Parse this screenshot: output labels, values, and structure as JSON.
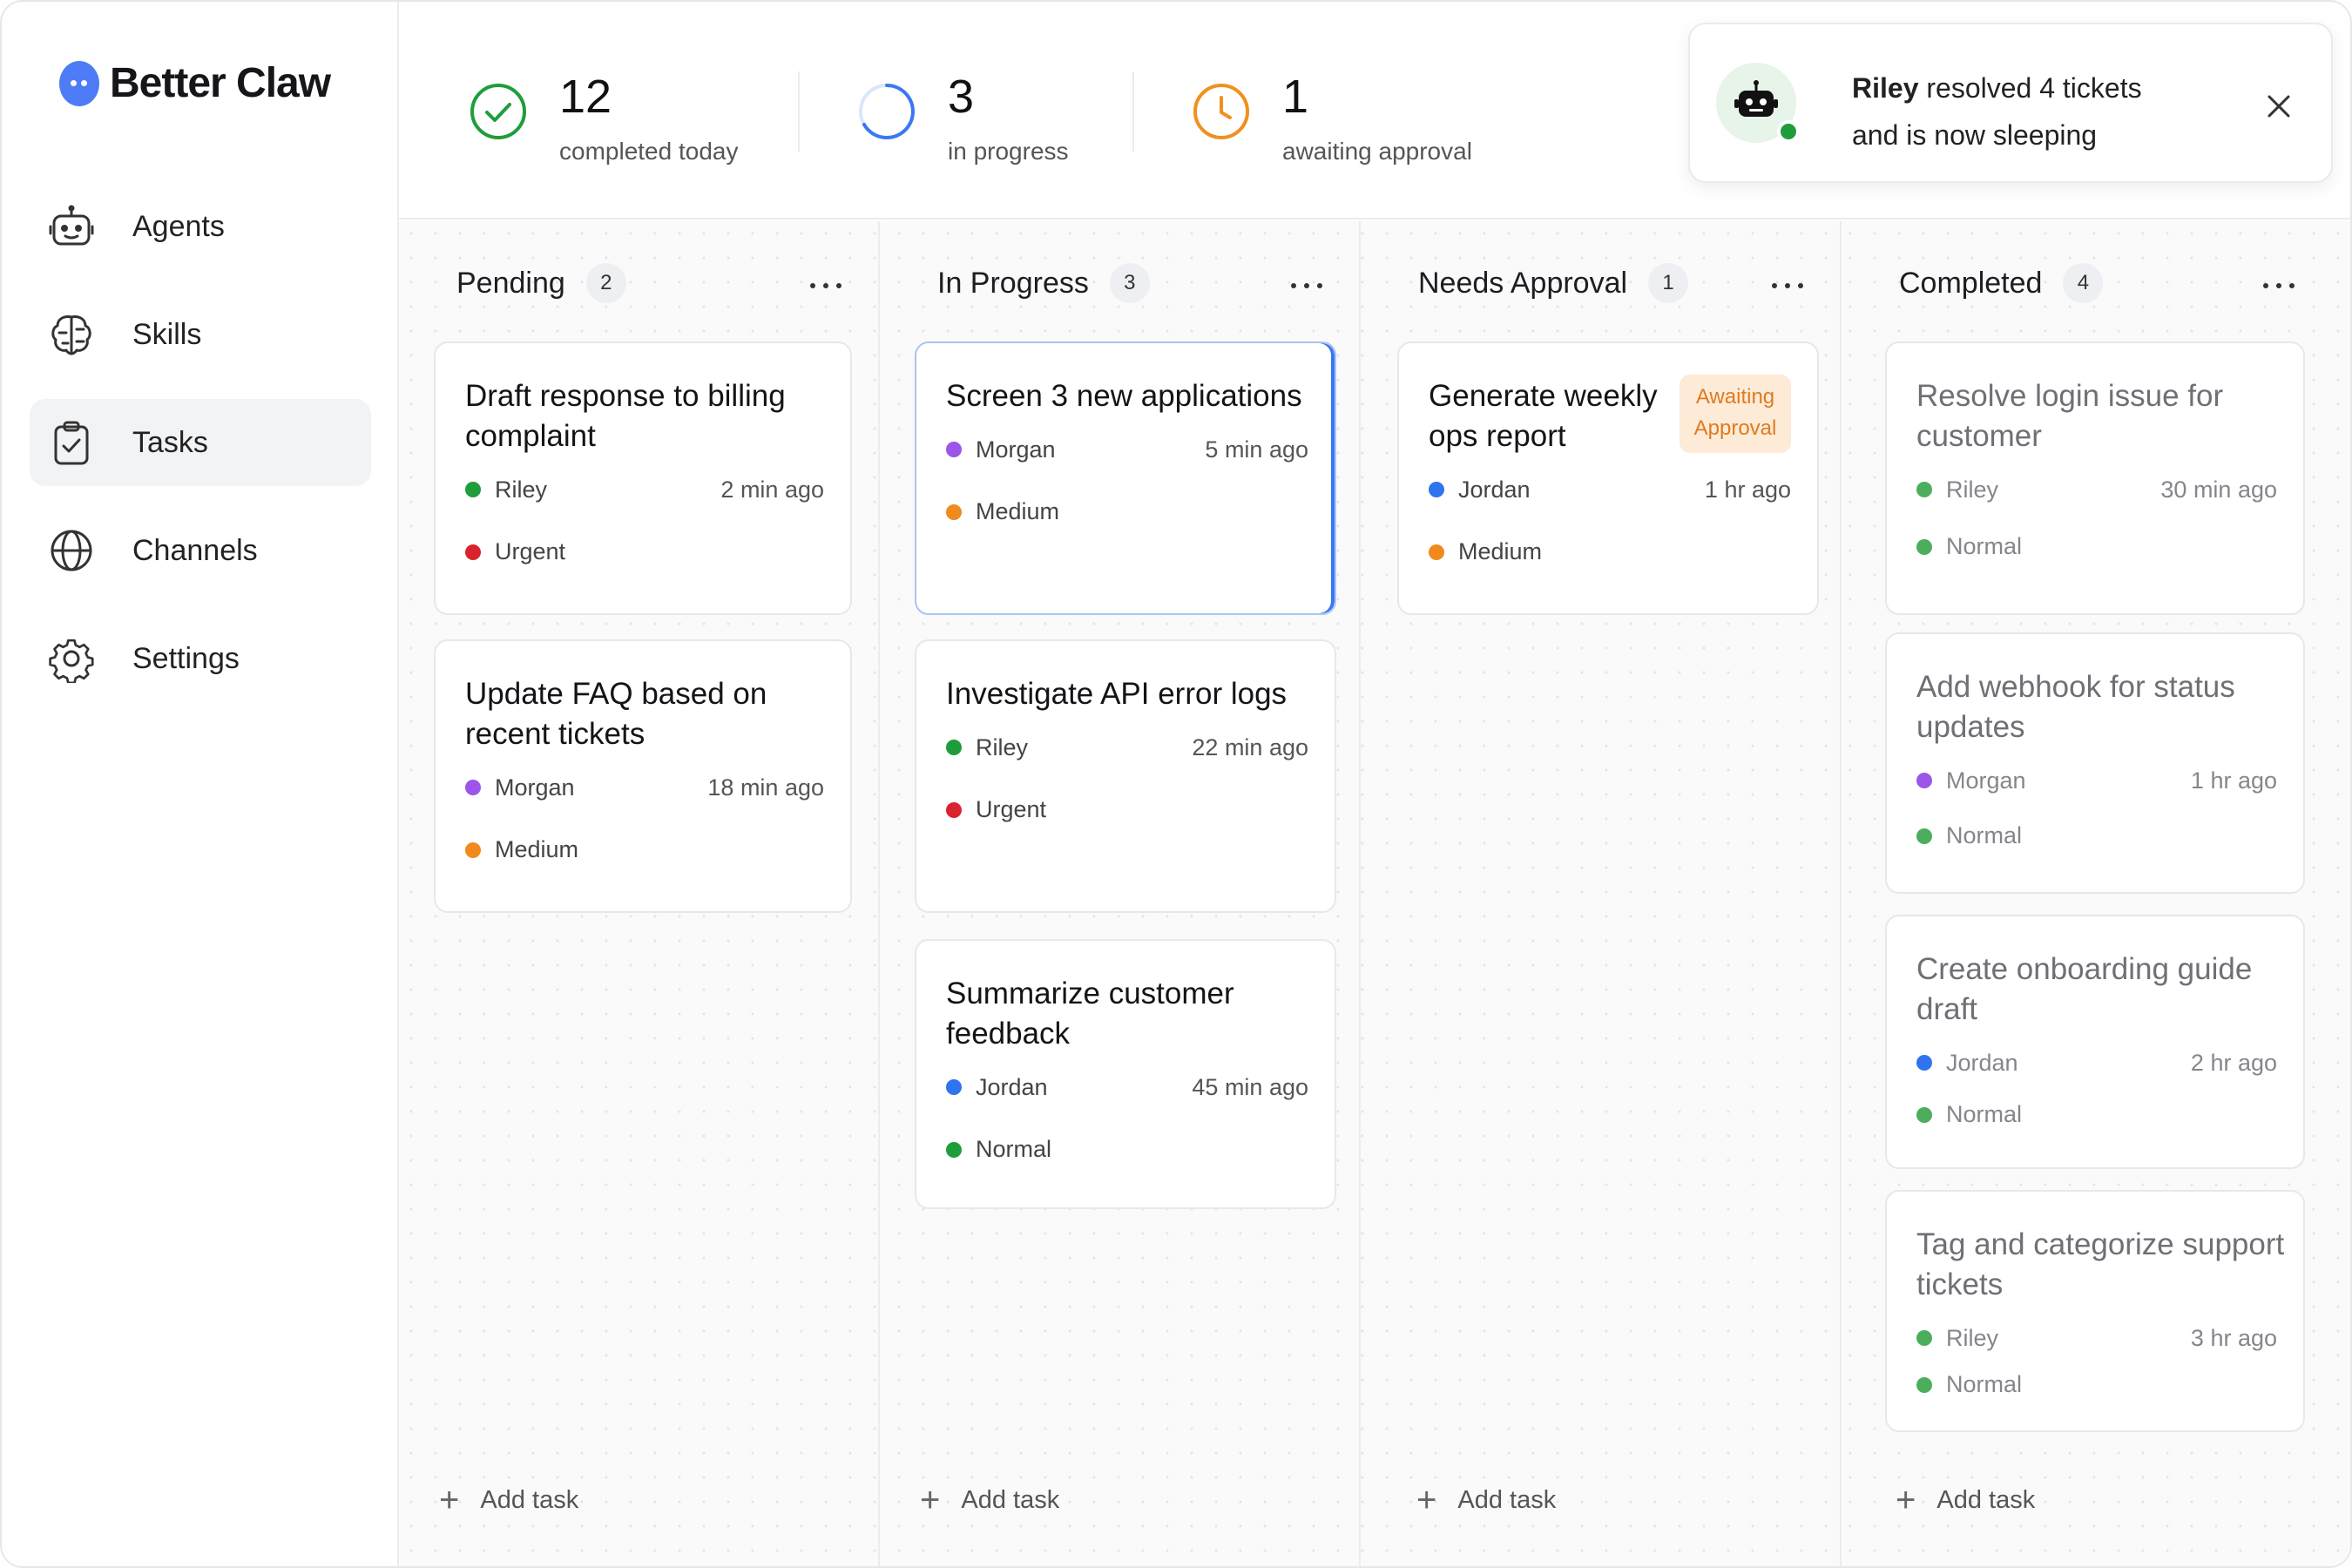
{
  "brand": {
    "name": "Better Claw"
  },
  "sidebar": {
    "items": [
      {
        "label": "Agents",
        "icon": "robot-icon"
      },
      {
        "label": "Skills",
        "icon": "brain-icon"
      },
      {
        "label": "Tasks",
        "icon": "clipboard-check-icon",
        "active": true
      },
      {
        "label": "Channels",
        "icon": "globe-icon"
      },
      {
        "label": "Settings",
        "icon": "gear-icon"
      }
    ]
  },
  "stats": [
    {
      "value": "12",
      "label": "completed today",
      "icon": "check-circle-icon",
      "color": "#1f9d3a"
    },
    {
      "value": "3",
      "label": "in progress",
      "icon": "progress-ring-icon",
      "color": "#3a78f2"
    },
    {
      "value": "1",
      "label": "awaiting approval",
      "icon": "clock-icon",
      "color": "#f0901f"
    }
  ],
  "toast": {
    "name": "Riley",
    "line1": " resolved 4 tickets",
    "line2": "and is now sleeping",
    "icon": "robot-icon",
    "status_color": "#1f9d3a"
  },
  "colors": {
    "Riley": "#1f9d3a",
    "Morgan": "#9b55e8",
    "Jordan": "#2f73ef",
    "Urgent": "#d9232e",
    "Medium": "#f08a1c",
    "Normal": "#1f9d3a",
    "done_green": "#4cae5d"
  },
  "columns": [
    {
      "title": "Pending",
      "count": "2",
      "add_label": "Add task",
      "cards": [
        {
          "title": "Draft response to billing complaint",
          "assignee": "Riley",
          "time": "2 min ago",
          "priority": "Urgent"
        },
        {
          "title": "Update FAQ based on recent tickets",
          "assignee": "Morgan",
          "time": "18 min ago",
          "priority": "Medium"
        }
      ]
    },
    {
      "title": "In Progress",
      "count": "3",
      "add_label": "Add task",
      "cards": [
        {
          "title": "Screen 3 new applications",
          "assignee": "Morgan",
          "time": "5 min ago",
          "priority": "Medium"
        },
        {
          "title": "Investigate API error logs",
          "assignee": "Riley",
          "time": "22 min ago",
          "priority": "Urgent"
        },
        {
          "title": "Summarize customer feedback",
          "assignee": "Jordan",
          "time": "45 min ago",
          "priority": "Normal"
        }
      ]
    },
    {
      "title": "Needs Approval",
      "count": "1",
      "add_label": "Add task",
      "cards": [
        {
          "title": "Generate weekly ops report",
          "assignee": "Jordan",
          "time": "1 hr ago",
          "priority": "Medium",
          "badge_line1": "Awaiting",
          "badge_line2": "Approval"
        }
      ]
    },
    {
      "title": "Completed",
      "count": "4",
      "add_label": "Add task",
      "cards": [
        {
          "title": "Resolve login issue for customer",
          "assignee": "Riley",
          "time": "30 min ago",
          "priority": "Normal"
        },
        {
          "title": "Add webhook for status updates",
          "assignee": "Morgan",
          "time": "1 hr ago",
          "priority": "Normal"
        },
        {
          "title": "Create onboarding guide draft",
          "assignee": "Jordan",
          "time": "2 hr ago",
          "priority": "Normal"
        },
        {
          "title": "Tag and categorize support tickets",
          "assignee": "Riley",
          "time": "3 hr ago",
          "priority": "Normal"
        }
      ]
    }
  ]
}
